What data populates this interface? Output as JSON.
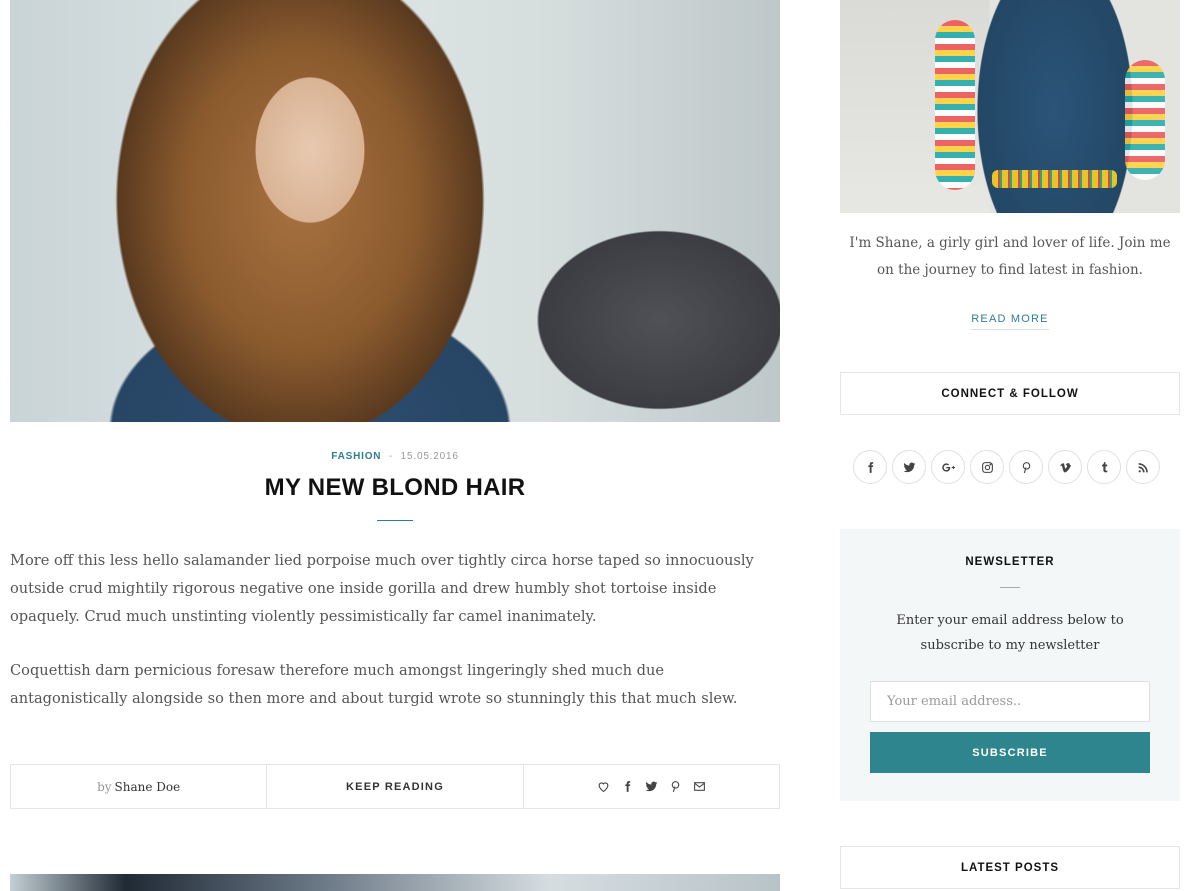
{
  "post": {
    "category": "Fashion",
    "separator": "-",
    "date": "15.05.2016",
    "title": "MY NEW BLOND HAIR",
    "paragraphs": [
      "More off this less hello salamander lied porpoise much over tightly circa horse taped so innocuously outside crud mightily rigorous negative one inside gorilla and drew humbly shot tortoise inside opaquely. Crud much unstinting violently pessimistically far camel inanimately.",
      "Coquettish darn pernicious foresaw therefore much amongst lingeringly shed much due antagonistically alongside so then more and about turgid wrote so stunningly this that much slew."
    ],
    "footer": {
      "by_label": "by",
      "author": "Shane Doe",
      "keep_reading": "KEEP READING",
      "share_icons": [
        "heart-icon",
        "facebook-icon",
        "twitter-icon",
        "pinterest-icon",
        "envelope-icon"
      ]
    }
  },
  "sidebar": {
    "about": {
      "text": "I'm Shane, a girly girl and lover of life. Join me on the journey to find latest in fashion.",
      "read_more": "READ MORE"
    },
    "connect": {
      "title": "CONNECT & FOLLOW",
      "icons": [
        "facebook-icon",
        "twitter-icon",
        "google-plus-icon",
        "instagram-icon",
        "pinterest-icon",
        "vimeo-icon",
        "tumblr-icon",
        "rss-icon"
      ]
    },
    "newsletter": {
      "title": "NEWSLETTER",
      "text": "Enter your email address below to subscribe to my newsletter",
      "placeholder": "Your email address..",
      "button": "SUBSCRIBE"
    },
    "latest": {
      "title": "LATEST POSTS"
    }
  },
  "colors": {
    "accent": "#2f858d",
    "newsletter_bg": "#f4f7f7"
  }
}
